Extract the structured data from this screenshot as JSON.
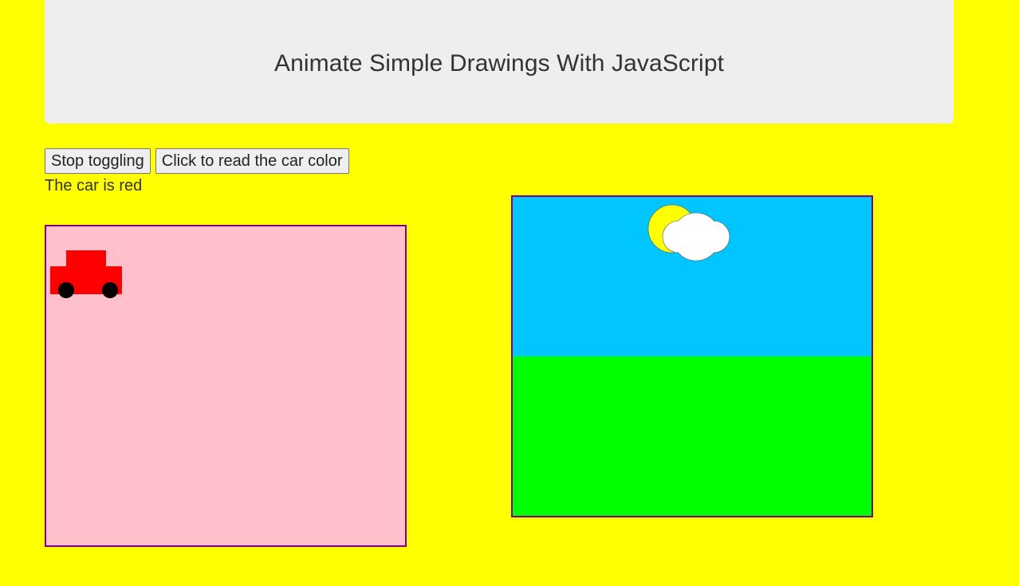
{
  "header": {
    "title": "Animate Simple Drawings With JavaScript"
  },
  "controls": {
    "stop_label": "Stop toggling",
    "read_color_label": "Click to read the car color"
  },
  "status": {
    "text": "The car is red"
  },
  "car_canvas": {
    "background": "#ffc0cb",
    "border_color": "#800080",
    "car_color": "#ff0000",
    "wheel_color": "#000000"
  },
  "scene_canvas": {
    "sky_color": "#00c5ff",
    "grass_color": "#00ff00",
    "sun_color": "#ffff00",
    "cloud_color": "#ffffff",
    "border_color": "#800080"
  }
}
